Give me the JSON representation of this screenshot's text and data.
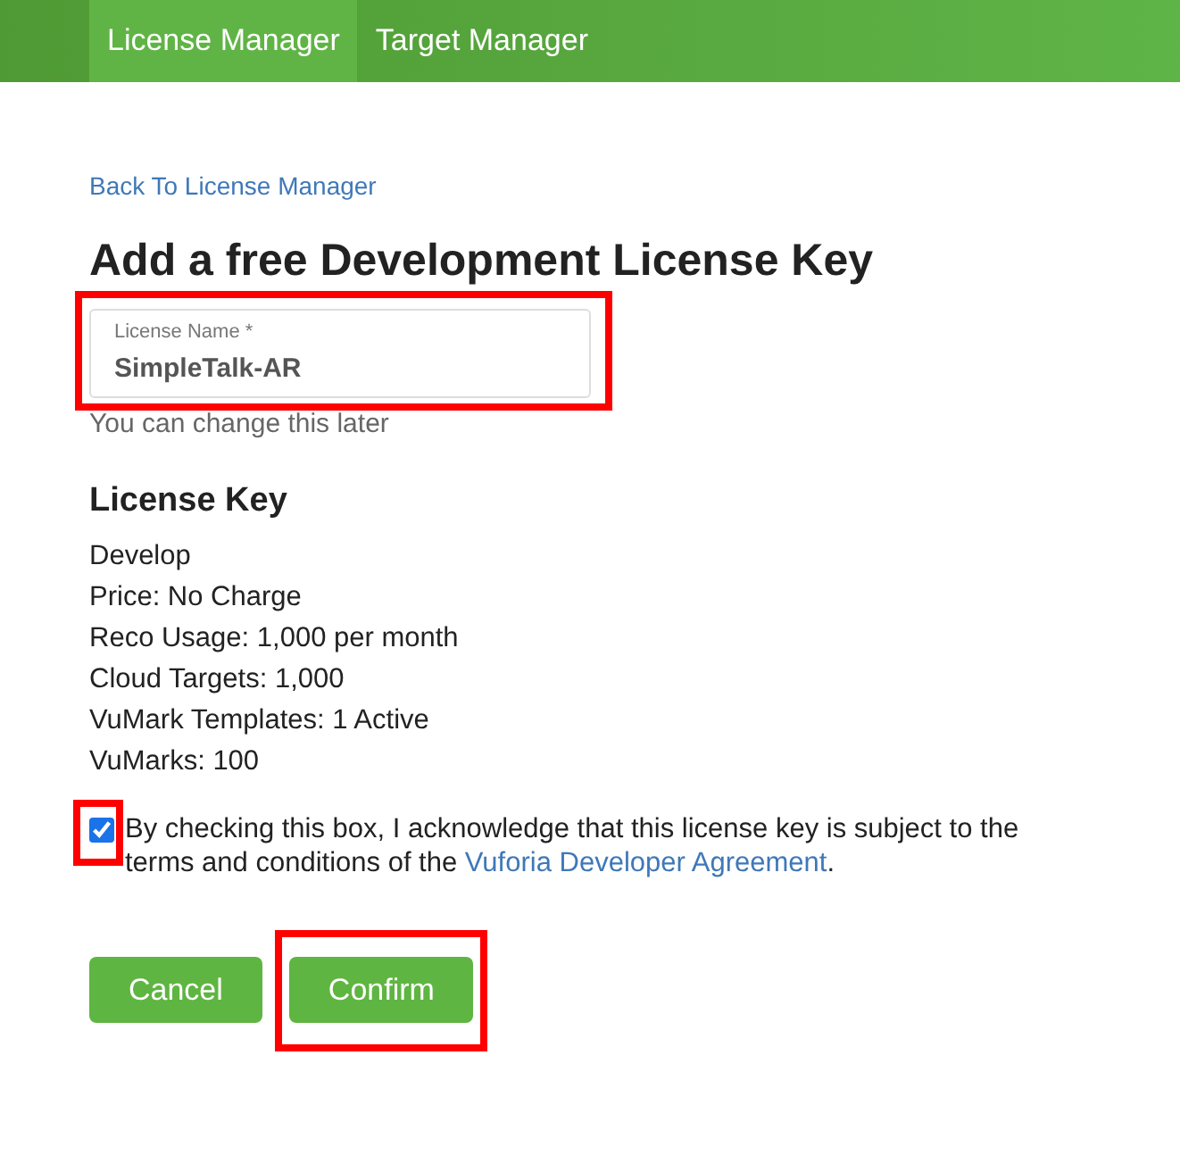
{
  "nav": {
    "tabs": [
      {
        "label": "License Manager",
        "selected": true
      },
      {
        "label": "Target Manager",
        "selected": false
      }
    ]
  },
  "back_link": "Back To License Manager",
  "title": "Add a free Development License Key",
  "license_name": {
    "label": "License Name *",
    "value": "SimpleTalk-AR",
    "hint": "You can change this later",
    "highlighted": true
  },
  "license_key": {
    "heading": "License Key",
    "lines": [
      "Develop",
      "Price: No Charge",
      "Reco Usage: 1,000 per month",
      "Cloud Targets: 1,000",
      "VuMark Templates: 1 Active",
      "VuMarks: 100"
    ]
  },
  "agreement": {
    "checked": true,
    "highlighted": true,
    "text_before": "By checking this box, I acknowledge that this license key is subject to the terms and conditions of the ",
    "link": "Vuforia Developer Agreement",
    "text_after": "."
  },
  "buttons": [
    {
      "label": "Cancel",
      "highlighted": false
    },
    {
      "label": "Confirm",
      "highlighted": true
    }
  ]
}
